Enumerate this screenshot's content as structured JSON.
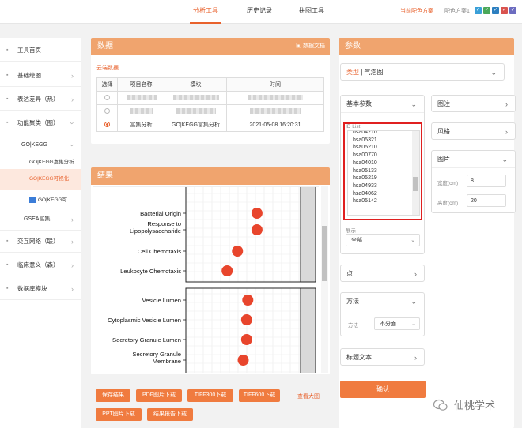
{
  "nav": {
    "analysis": "分析工具",
    "history": "历史记录",
    "collage": "拼图工具",
    "current_scheme": "当前配色方案",
    "scheme_label": "配色方案1"
  },
  "sidebar": {
    "items": [
      {
        "label": "工具首页",
        "bullet": "▪"
      },
      {
        "label": "基础绘图",
        "bullet": "▪",
        "arrow": "›"
      },
      {
        "label": "表达差异（热）",
        "bullet": "▪",
        "arrow": "›"
      },
      {
        "label": "功能聚类（图）",
        "bullet": "▪",
        "arrow": "›"
      },
      {
        "label": "交互网络（联）",
        "bullet": "▪",
        "arrow": "›"
      },
      {
        "label": "临床意义（森）",
        "bullet": "▪",
        "arrow": "›"
      },
      {
        "label": "数据库模块",
        "bullet": "▪",
        "arrow": "›"
      }
    ],
    "sub": {
      "gokegg": "GO|KEGG",
      "gokegg_analysis": "GO|KEGG富集分析",
      "gokegg_vis": "GO|KEGG可视化",
      "gokegg_more": "GO|KEGG可...",
      "gsea": "GSEA富集"
    }
  },
  "data_panel": {
    "title": "数据",
    "doc": "数据文档",
    "cloud": "云端数据",
    "headers": [
      "选择",
      "项目名称",
      "模块",
      "时间"
    ],
    "rows": [
      {
        "name": "富集分析",
        "module": "GO|KEGG富集分析",
        "time": "2021-05-08 16:20:31"
      }
    ]
  },
  "result_panel": {
    "title": "结果",
    "chart_data": {
      "type": "scatter",
      "categories": [
        "Bacterial Origin",
        "Response to Lipopolysaccharide",
        "Cell Chemotaxis",
        "Leukocyte Chemotaxis",
        "Vesicle Lumen",
        "Cytoplasmic Vesicle Lumen",
        "Secretory Granule Lumen",
        "Secretory Granule Membrane"
      ],
      "category_lines": [
        [
          "Bacterial Origin"
        ],
        [
          "Response to",
          "Lipopolysaccharide"
        ],
        [
          "Cell Chemotaxis"
        ],
        [
          "Leukocyte Chemotaxis"
        ],
        [
          "Vesicle Lumen"
        ],
        [
          "Cytoplasmic Vesicle Lumen"
        ],
        [
          "Secretory Granule Lumen"
        ],
        [
          "Secretory Granule",
          "Membrane"
        ]
      ],
      "values": [
        0.62,
        0.62,
        0.45,
        0.36,
        0.54,
        0.53,
        0.53,
        0.5
      ],
      "color": "#e8452c"
    }
  },
  "buttons": [
    "保存结果",
    "PDF图片下载",
    "TIFF300下载",
    "TIFF600下载",
    "PPT图片下载",
    "结果报告下载"
  ],
  "view_large": "查看大图",
  "params": {
    "title": "参数",
    "type_label": "类型",
    "type_value": "气泡图",
    "basic": "基本参数",
    "id_list_label": "ID List",
    "ids": [
      "hsa04210",
      "hsa05321",
      "hsa05210",
      "hsa00770",
      "hsa04010",
      "hsa05133",
      "hsa05219",
      "hsa04933",
      "hsa04062",
      "hsa05142"
    ],
    "display_label": "展示",
    "display_value": "全部",
    "point": "点",
    "method": "方法",
    "method_label": "方法",
    "method_value": "不分面",
    "title_text": "标题文本",
    "submit": "确认",
    "legend": "图注",
    "style": "风格",
    "image": "图片",
    "width_label": "宽度(cm)",
    "width": "8",
    "height_label": "高度(cm)",
    "height": "20"
  },
  "watermark": "仙桃学术",
  "colors": {
    "accent": "#e8612c",
    "header": "#f0a46e",
    "button": "#f07b3f"
  }
}
